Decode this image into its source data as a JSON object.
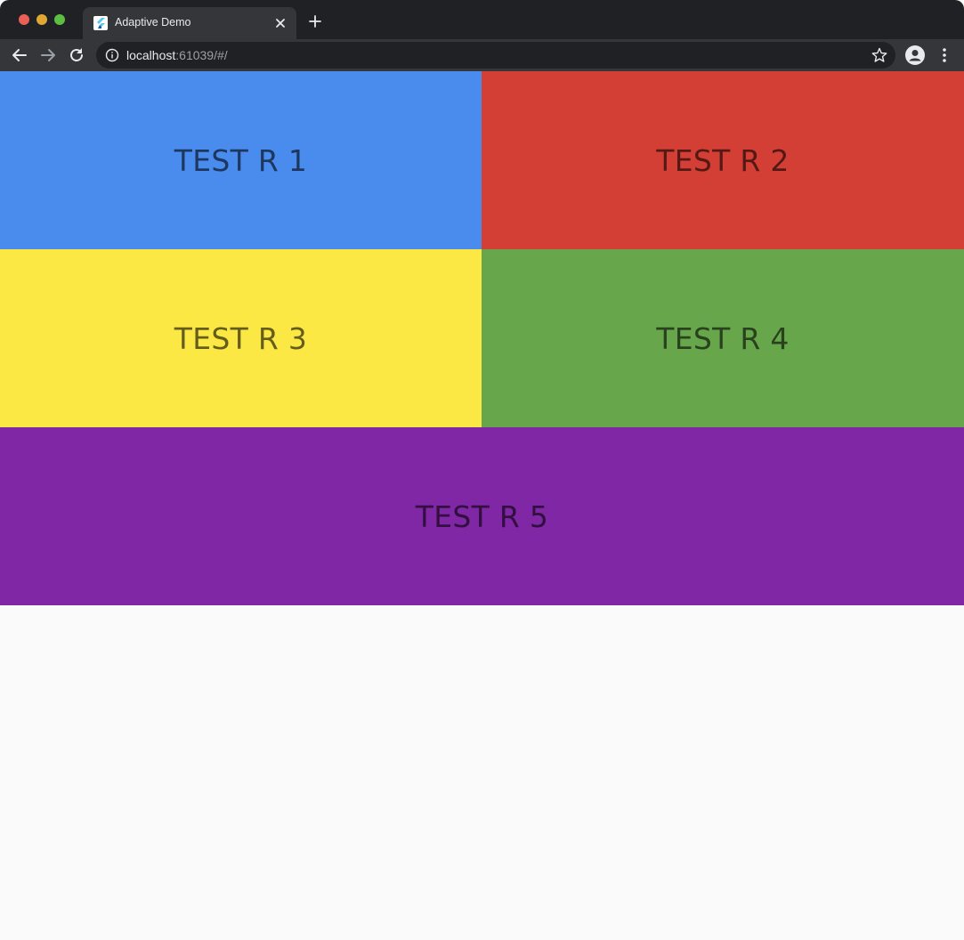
{
  "browser": {
    "tab_title": "Adaptive Demo",
    "url_host": "localhost",
    "url_rest": ":61039/#/"
  },
  "tiles": [
    {
      "label": "TEST R 1",
      "color": "#4a8bee"
    },
    {
      "label": "TEST R 2",
      "color": "#d43f35"
    },
    {
      "label": "TEST R 3",
      "color": "#fbe845"
    },
    {
      "label": "TEST R 4",
      "color": "#67a64b"
    },
    {
      "label": "TEST R 5",
      "color": "#7f27a4"
    }
  ],
  "icons": {
    "favicon": "flutter-icon",
    "tab_close": "close-icon",
    "new_tab": "plus-icon",
    "back": "back-arrow-icon",
    "forward": "forward-arrow-icon",
    "reload": "reload-icon",
    "site_info": "info-icon",
    "bookmark": "star-icon",
    "profile": "profile-icon",
    "menu": "kebab-menu-icon"
  }
}
